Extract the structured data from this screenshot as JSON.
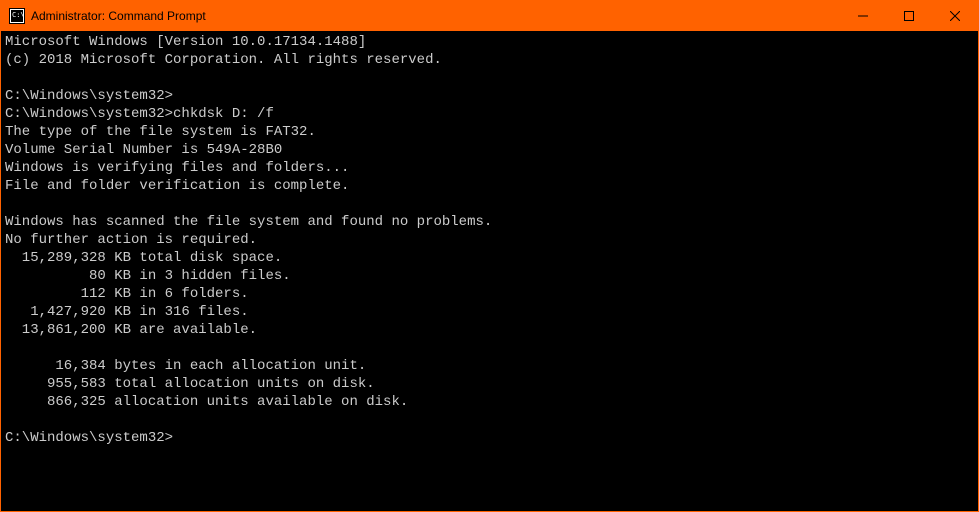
{
  "window": {
    "title": "Administrator: Command Prompt"
  },
  "terminal": {
    "lines": [
      "Microsoft Windows [Version 10.0.17134.1488]",
      "(c) 2018 Microsoft Corporation. All rights reserved.",
      "",
      "C:\\Windows\\system32>",
      "C:\\Windows\\system32>chkdsk D: /f",
      "The type of the file system is FAT32.",
      "Volume Serial Number is 549A-28B0",
      "Windows is verifying files and folders...",
      "File and folder verification is complete.",
      "",
      "Windows has scanned the file system and found no problems.",
      "No further action is required.",
      "  15,289,328 KB total disk space.",
      "          80 KB in 3 hidden files.",
      "         112 KB in 6 folders.",
      "   1,427,920 KB in 316 files.",
      "  13,861,200 KB are available.",
      "",
      "      16,384 bytes in each allocation unit.",
      "     955,583 total allocation units on disk.",
      "     866,325 allocation units available on disk.",
      "",
      "C:\\Windows\\system32>"
    ]
  }
}
